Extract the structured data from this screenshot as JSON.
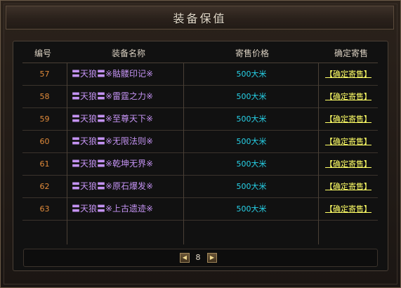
{
  "window": {
    "title": "装备保值"
  },
  "table": {
    "headers": {
      "num": "编号",
      "name": "装备名称",
      "price": "寄售价格",
      "action": "确定寄售"
    },
    "rows": [
      {
        "num": "57",
        "name": "〓天狼〓※骷髅印记※",
        "price": "500大米",
        "action": "【确定寄售】"
      },
      {
        "num": "58",
        "name": "〓天狼〓※雷霆之力※",
        "price": "500大米",
        "action": "【确定寄售】"
      },
      {
        "num": "59",
        "name": "〓天狼〓※至尊天下※",
        "price": "500大米",
        "action": "【确定寄售】"
      },
      {
        "num": "60",
        "name": "〓天狼〓※无限法则※",
        "price": "500大米",
        "action": "【确定寄售】"
      },
      {
        "num": "61",
        "name": "〓天狼〓※乾坤无界※",
        "price": "500大米",
        "action": "【确定寄售】"
      },
      {
        "num": "62",
        "name": "〓天狼〓※原石爆发※",
        "price": "500大米",
        "action": "【确定寄售】"
      },
      {
        "num": "63",
        "name": "〓天狼〓※上古遗迹※",
        "price": "500大米",
        "action": "【确定寄售】"
      }
    ]
  },
  "pager": {
    "page": "8",
    "prev_icon": "prev-arrow-icon",
    "next_icon": "next-arrow-icon"
  },
  "colors": {
    "number": "#e08a3a",
    "name": "#c493f3",
    "price": "#27d3ea",
    "action": "#ffff66"
  }
}
